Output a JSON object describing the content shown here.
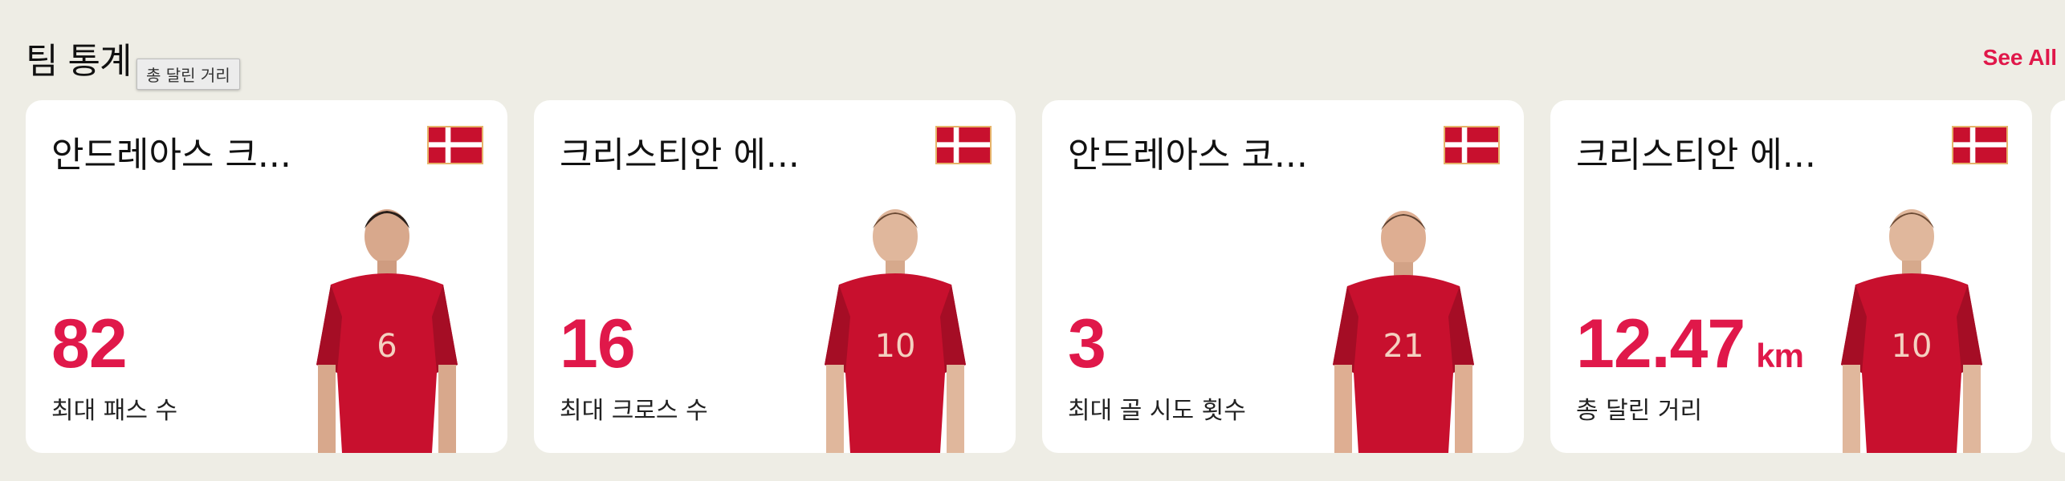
{
  "section": {
    "title": "팀 통계",
    "see_all_label": "See All",
    "tooltip": "총 달린 거리"
  },
  "cards": [
    {
      "player_name": "안드레아스 크...",
      "jersey": "6",
      "value": "82",
      "unit": "",
      "stat_label": "최대 패스 수"
    },
    {
      "player_name": "크리스티안 에...",
      "jersey": "10",
      "value": "16",
      "unit": "",
      "stat_label": "최대 크로스 수"
    },
    {
      "player_name": "안드레아스 코...",
      "jersey": "21",
      "value": "3",
      "unit": "",
      "stat_label": "최대 골 시도 횟수"
    },
    {
      "player_name": "크리스티안 에...",
      "jersey": "10",
      "value": "12.47",
      "unit": "km",
      "stat_label": "총 달린 거리"
    }
  ],
  "colors": {
    "accent": "#e0184a",
    "background": "#eeede5",
    "card": "#ffffff",
    "jersey_red": "#c8102e"
  },
  "icons": {
    "flag": "denmark-flag-icon",
    "player": "player-photo"
  }
}
